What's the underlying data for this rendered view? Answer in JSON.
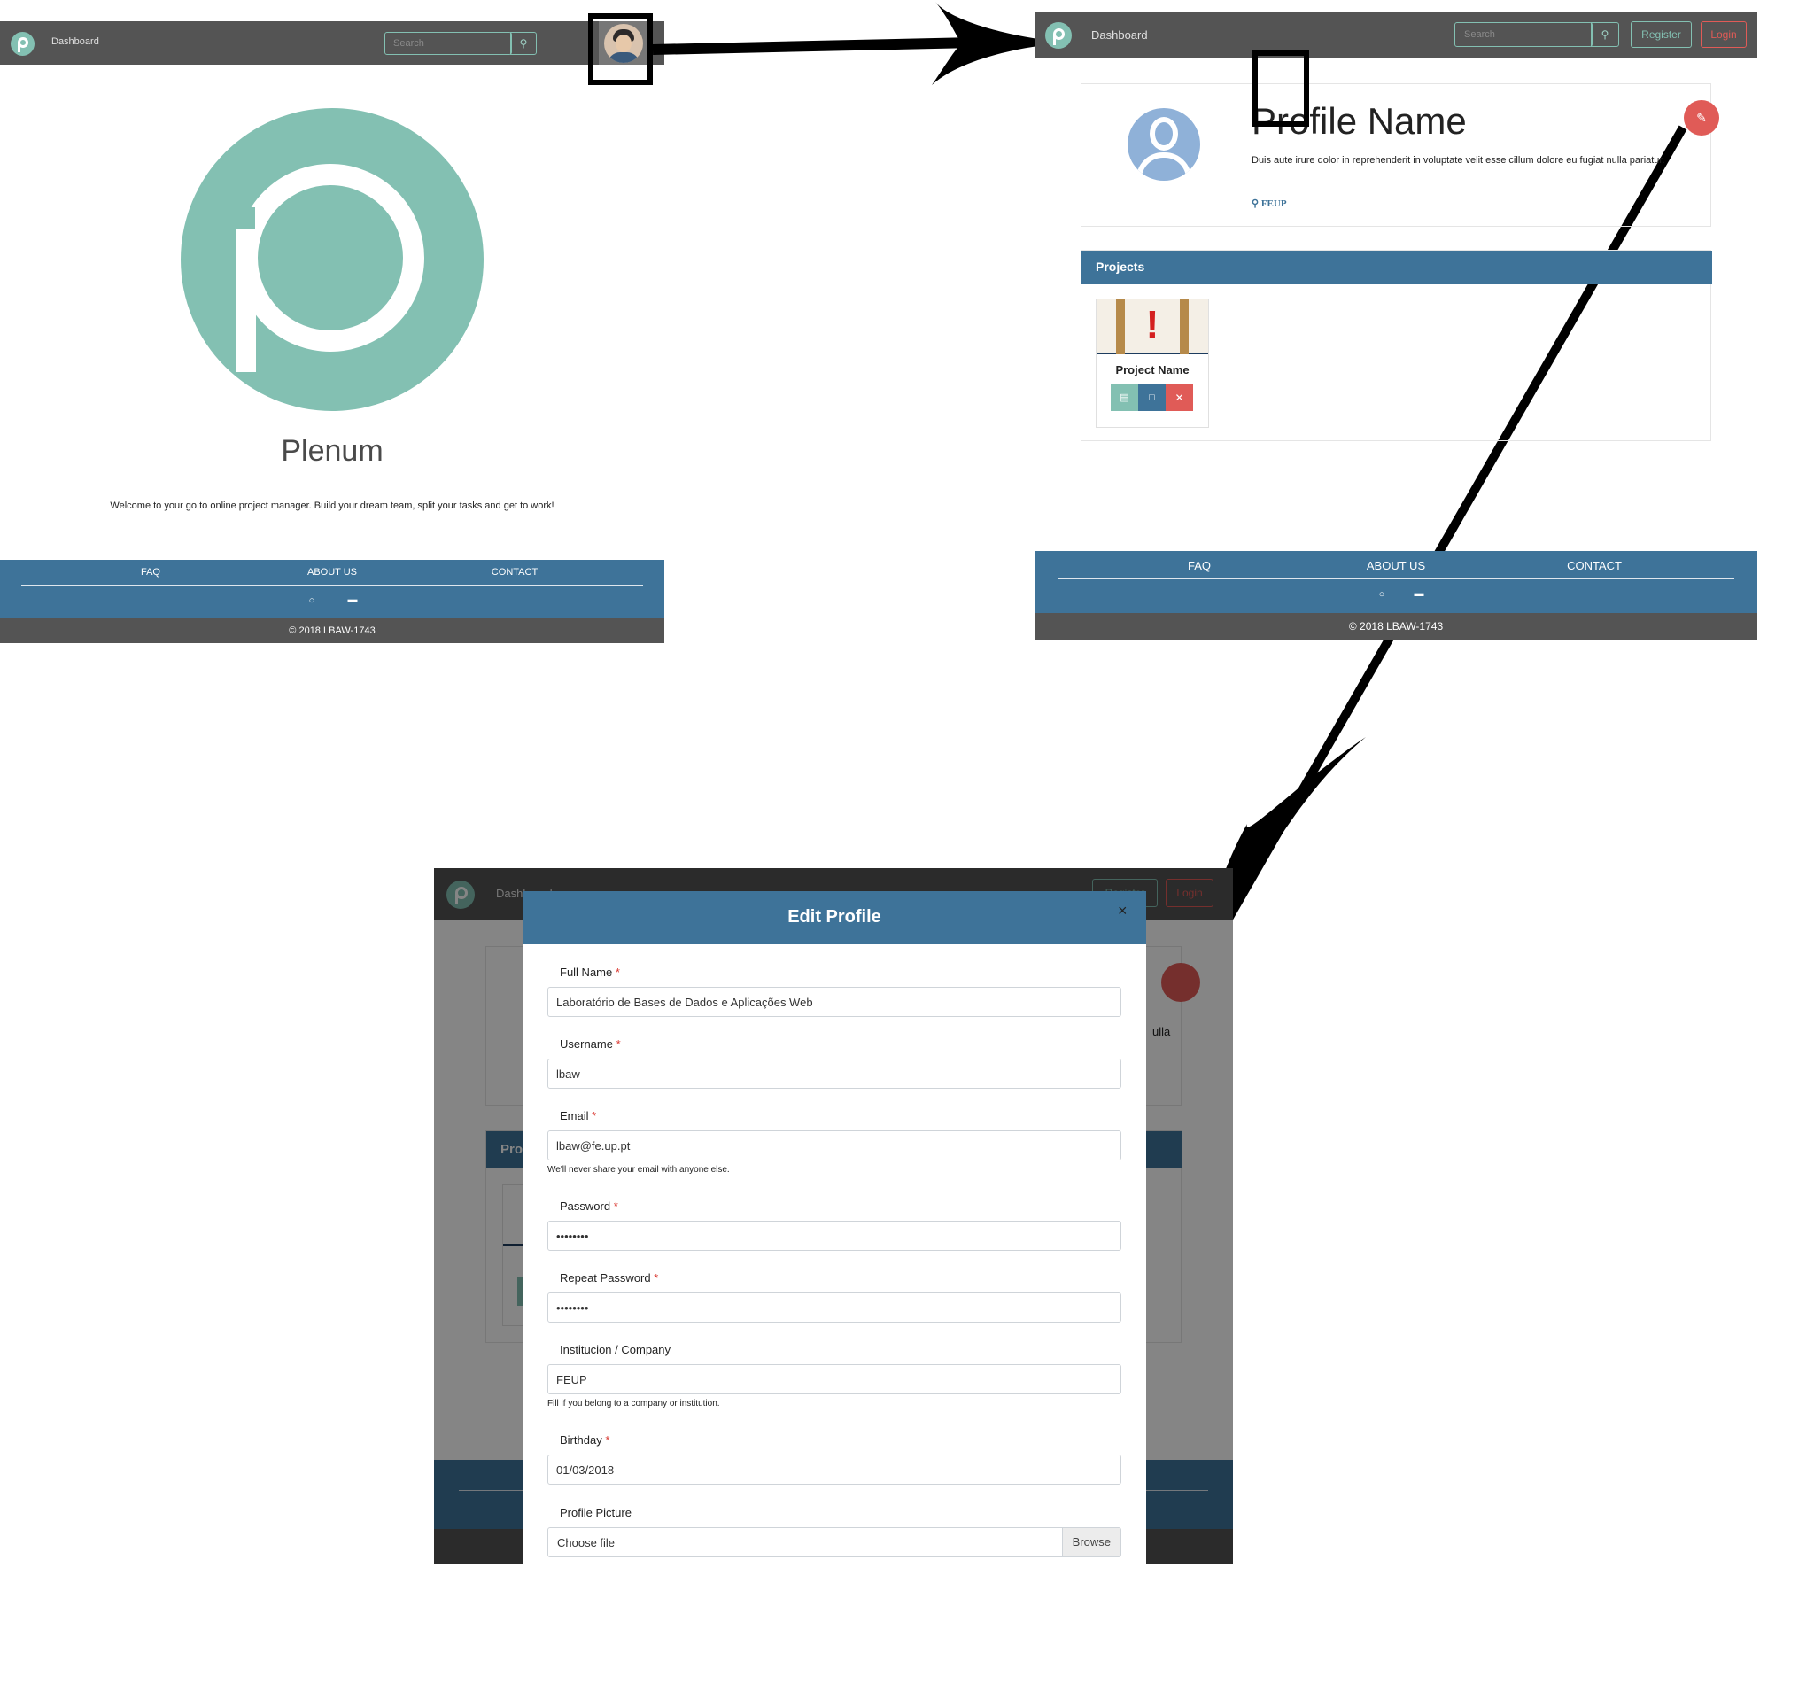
{
  "screen1": {
    "nav": {
      "dashboard": "Dashboard",
      "search_placeholder": "Search"
    },
    "logo_name": "Plenum",
    "welcome": "Welcome to your go to online project manager. Build your dream team, split your tasks and get to work!",
    "footer": {
      "faq": "FAQ",
      "about": "ABOUT US",
      "contact": "CONTACT",
      "copyright": "© 2018 LBAW-1743"
    }
  },
  "screen2": {
    "nav": {
      "dashboard": "Dashboard",
      "search_placeholder": "Search",
      "register": "Register",
      "login": "Login"
    },
    "profile": {
      "name": "Profile Name",
      "bio": "Duis aute irure dolor in reprehenderit in voluptate velit esse cillum dolore eu fugiat nulla pariatur.",
      "location": "FEUP"
    },
    "projects_title": "Projects",
    "project": {
      "name": "Project Name"
    },
    "footer": {
      "faq": "FAQ",
      "about": "ABOUT US",
      "contact": "CONTACT",
      "copyright": "© 2018 LBAW-1743"
    }
  },
  "screen3": {
    "nav": {
      "dashboard": "Dashboard",
      "register": "Register",
      "login": "Login"
    },
    "modal": {
      "title": "Edit Profile",
      "close": "×",
      "full_name_label": "Full Name",
      "full_name_value": "Laboratório de Bases de Dados e Aplicações Web",
      "username_label": "Username",
      "username_value": "lbaw",
      "email_label": "Email",
      "email_value": "lbaw@fe.up.pt",
      "email_help": "We'll never share your email with anyone else.",
      "password_label": "Password",
      "password_value": "••••••••",
      "repeat_password_label": "Repeat Password",
      "repeat_password_value": "••••••••",
      "company_label": "Institucion / Company",
      "company_value": "FEUP",
      "company_help": "Fill if you belong to a company or institution.",
      "birthday_label": "Birthday",
      "birthday_value": "01/03/2018",
      "picture_label": "Profile Picture",
      "file_placeholder": "Choose file",
      "browse": "Browse",
      "required_mark": "*"
    },
    "background_fragments": {
      "projects_fragment": "Pro",
      "bio_fragment": "ulla"
    }
  },
  "colors": {
    "teal": "#83c0b2",
    "blue": "#3e7399",
    "red": "#e05b57",
    "dark": "#545454"
  }
}
